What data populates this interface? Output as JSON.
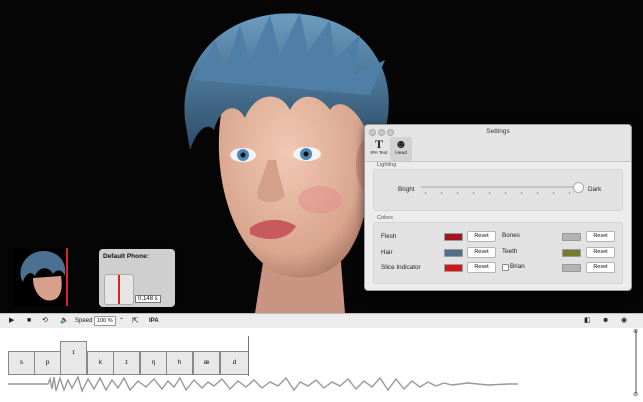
{
  "settings": {
    "window_title": "Settings",
    "tabs": [
      {
        "label": "IPA Text",
        "glyph": "T"
      },
      {
        "label": "Head",
        "glyph": "☻"
      }
    ],
    "lighting": {
      "group_title": "Lighting",
      "bright_label": "Bright",
      "dark_label": "Dark",
      "level": 0.97
    },
    "colors": {
      "group_title": "Colors",
      "flesh": {
        "label": "Flesh",
        "color": "#a3141c",
        "reset": "Reset"
      },
      "hair": {
        "label": "Hair",
        "color": "#4e7088",
        "reset": "Reset"
      },
      "slice": {
        "label": "Slice Indicator",
        "color": "#d8141a",
        "reset": "Reset"
      },
      "bones": {
        "label": "Bones",
        "color": "#b3b3b3",
        "reset": "Reset"
      },
      "teeth": {
        "label": "Teeth",
        "color": "#7a7a2e",
        "reset": "Reset"
      },
      "brian": {
        "label": "Brian",
        "color": "#b3b3b3",
        "reset": "Reset"
      }
    }
  },
  "popup": {
    "title": "Default Phone:",
    "time": "0,148 s"
  },
  "toolbar": {
    "speed_label": "Speed",
    "speed_value": "100 %",
    "ipa_label": "IPA"
  },
  "phonemes": [
    "s",
    "p",
    "ɪ",
    "k",
    "ɪ",
    "ŋ",
    "h",
    "æ",
    "d"
  ],
  "colors": {
    "hair": "#4a7192",
    "skin": "#e6b59f",
    "accent_red": "#d22222"
  }
}
